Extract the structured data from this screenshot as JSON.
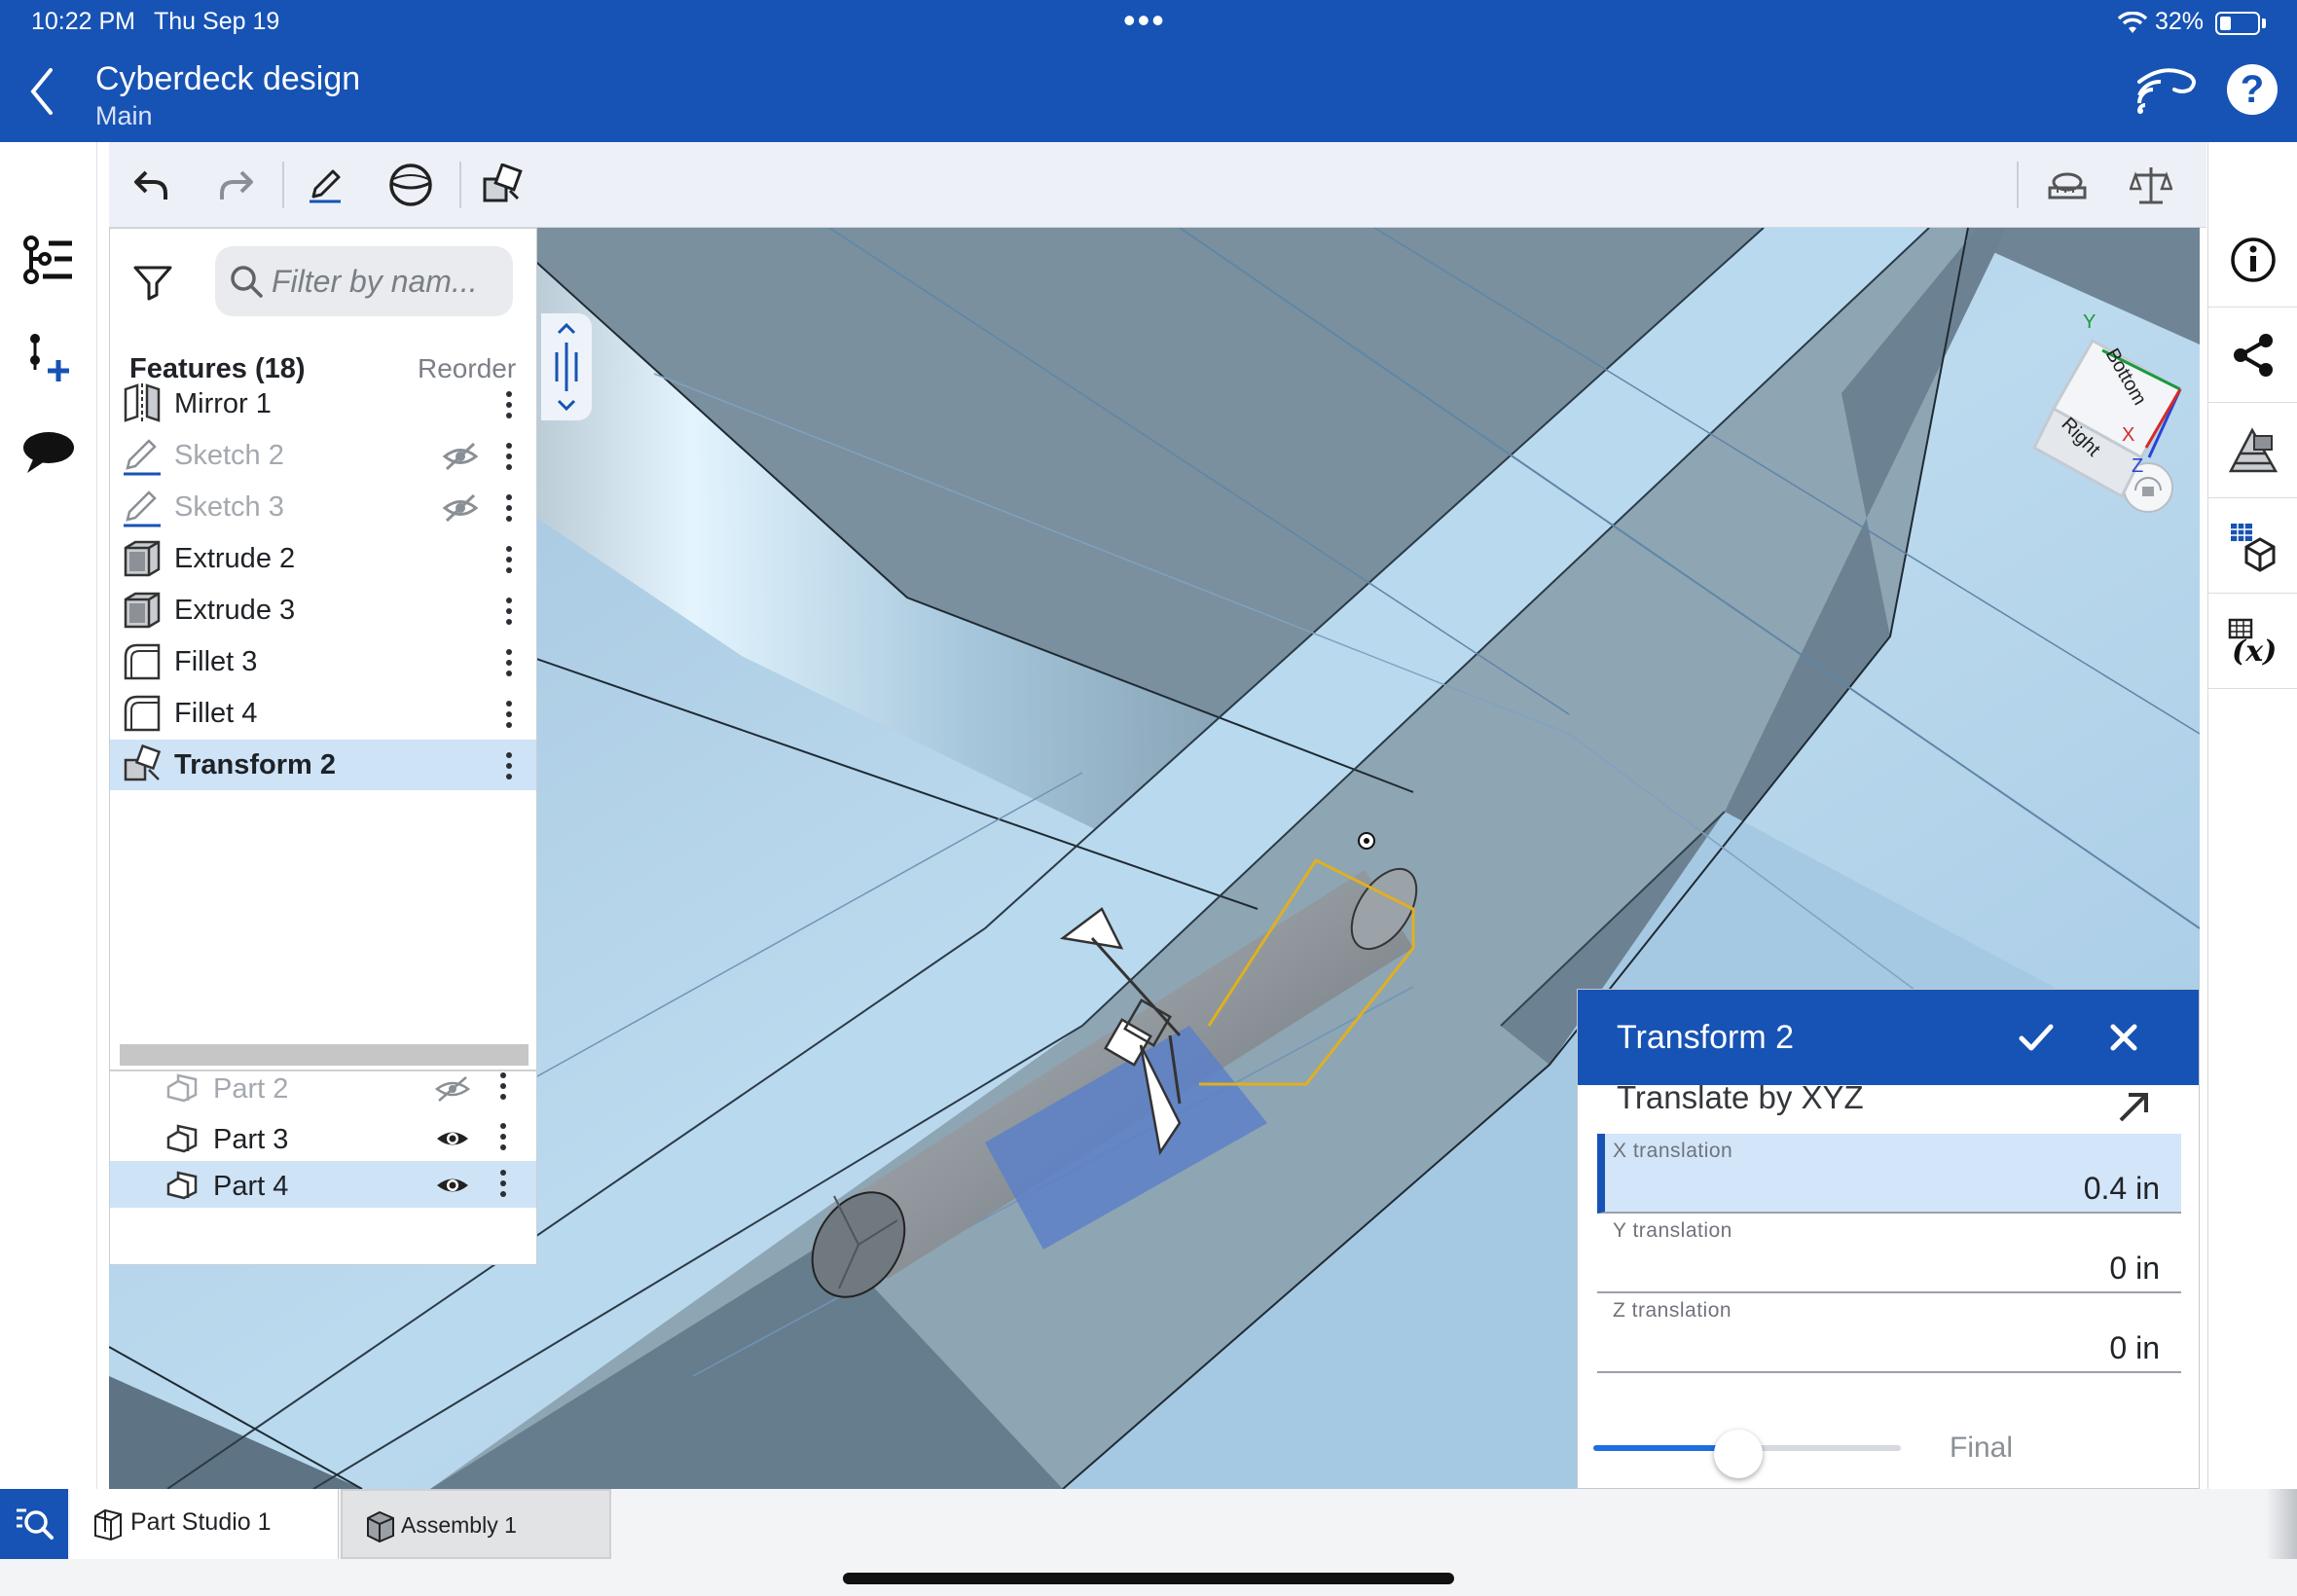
{
  "status_bar": {
    "time": "10:22 PM",
    "date": "Thu Sep 19",
    "dots": "•••",
    "battery_percent": "32%"
  },
  "header": {
    "title": "Cyberdeck design",
    "branch": "Main",
    "help_label": "?"
  },
  "colors": {
    "brand": "#1753b4",
    "selected_row": "#cfe3f7",
    "viewport_blue": "#aacde6"
  },
  "toolbar": {
    "icons": [
      "undo-icon",
      "redo-icon",
      "sketch-pencil-icon",
      "sphere-view-icon",
      "transform-icon",
      "measure-icon",
      "mass-properties-icon"
    ]
  },
  "left_rail": {
    "icons": [
      "feature-tree-icon",
      "insert-feature-icon",
      "comments-icon"
    ]
  },
  "right_rail": {
    "icons": [
      "info-icon",
      "share-icon",
      "appearance-icon",
      "configurations-icon",
      "variables-icon"
    ]
  },
  "feature_panel": {
    "filter_placeholder": "Filter by nam...",
    "features_title": "Features (18)",
    "reorder_label": "Reorder",
    "features": [
      {
        "label": "Mirror 1",
        "icon": "mirror-icon",
        "suppressed": false,
        "hidden": false,
        "selected": false
      },
      {
        "label": "Sketch 2",
        "icon": "sketch-icon",
        "suppressed": true,
        "hidden": true,
        "selected": false
      },
      {
        "label": "Sketch 3",
        "icon": "sketch-icon",
        "suppressed": true,
        "hidden": true,
        "selected": false
      },
      {
        "label": "Extrude 2",
        "icon": "extrude-icon",
        "suppressed": false,
        "hidden": false,
        "selected": false
      },
      {
        "label": "Extrude 3",
        "icon": "extrude-icon",
        "suppressed": false,
        "hidden": false,
        "selected": false
      },
      {
        "label": "Fillet 3",
        "icon": "fillet-icon",
        "suppressed": false,
        "hidden": false,
        "selected": false
      },
      {
        "label": "Fillet 4",
        "icon": "fillet-icon",
        "suppressed": false,
        "hidden": false,
        "selected": false
      },
      {
        "label": "Transform 2",
        "icon": "transform-icon",
        "suppressed": false,
        "hidden": false,
        "selected": true
      }
    ],
    "parts": [
      {
        "label": "Part 2",
        "visible": false,
        "selected": false
      },
      {
        "label": "Part 3",
        "visible": true,
        "selected": false
      },
      {
        "label": "Part 4",
        "visible": true,
        "selected": true
      }
    ]
  },
  "view_cube": {
    "face_top": "Bottom",
    "face_front": "Right",
    "axis_y": "Y",
    "axis_x": "X",
    "axis_z": "Z"
  },
  "transform_dialog": {
    "title": "Transform 2",
    "mode": "Translate by XYZ",
    "fields": [
      {
        "label": "X translation",
        "value": "0.4 in",
        "active": true
      },
      {
        "label": "Y translation",
        "value": "0 in",
        "active": false
      },
      {
        "label": "Z translation",
        "value": "0 in",
        "active": false
      }
    ],
    "slider_label": "Final",
    "slider_fraction": 0.47
  },
  "tabs": [
    {
      "label": "Part Studio 1",
      "icon": "part-studio-icon",
      "active": true
    },
    {
      "label": "Assembly 1",
      "icon": "assembly-icon",
      "active": false
    }
  ]
}
